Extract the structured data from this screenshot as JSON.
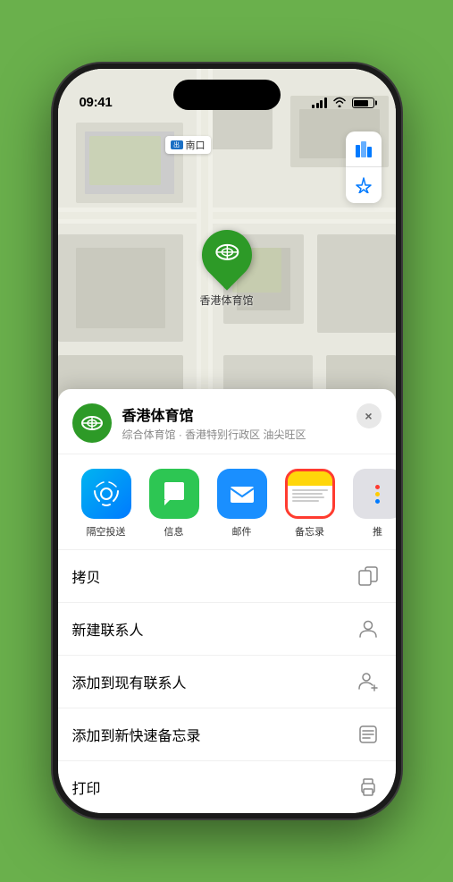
{
  "statusBar": {
    "time": "09:41",
    "showLocation": true
  },
  "map": {
    "locationLabel": "南口",
    "markerName": "香港体育馆",
    "controls": {
      "mapType": "🗺",
      "location": "➤"
    }
  },
  "locationCard": {
    "name": "香港体育馆",
    "subtitle": "综合体育馆 · 香港特别行政区 油尖旺区",
    "closeLabel": "×"
  },
  "shareRow": {
    "items": [
      {
        "id": "airdrop",
        "label": "隔空投送"
      },
      {
        "id": "messages",
        "label": "信息"
      },
      {
        "id": "mail",
        "label": "邮件"
      },
      {
        "id": "notes",
        "label": "备忘录",
        "selected": true
      },
      {
        "id": "more",
        "label": "推"
      }
    ]
  },
  "actions": [
    {
      "id": "copy",
      "label": "拷贝",
      "icon": "copy"
    },
    {
      "id": "new-contact",
      "label": "新建联系人",
      "icon": "person"
    },
    {
      "id": "add-existing",
      "label": "添加到现有联系人",
      "icon": "person-add"
    },
    {
      "id": "add-note",
      "label": "添加到新快速备忘录",
      "icon": "note"
    },
    {
      "id": "print",
      "label": "打印",
      "icon": "print"
    }
  ]
}
